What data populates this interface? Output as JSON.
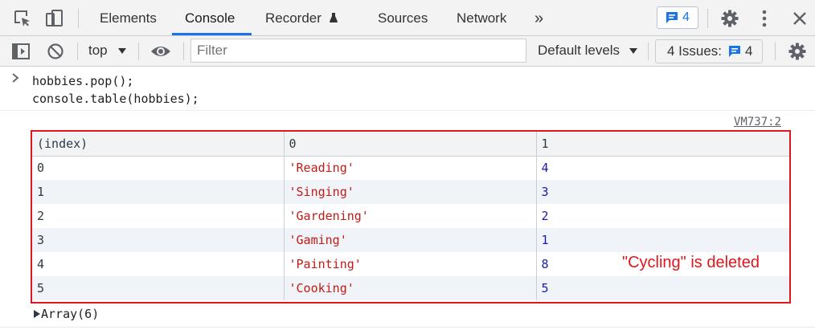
{
  "tabs": [
    {
      "label": "Elements"
    },
    {
      "label": "Console"
    },
    {
      "label": "Recorder"
    },
    {
      "label": "Sources"
    },
    {
      "label": "Network"
    }
  ],
  "active_tab": "Console",
  "more_tabs_glyph": "»",
  "message_badge_count": "4",
  "toolbar": {
    "context": "top",
    "filter_placeholder": "Filter",
    "levels_label": "Default levels",
    "issues_label": "4 Issues:",
    "issues_count": "4"
  },
  "console_input": {
    "line1": "hobbies.pop();",
    "line2": "console.table(hobbies);"
  },
  "source_link": "VM737:2",
  "table": {
    "headers": [
      "(index)",
      "0",
      "1"
    ],
    "rows": [
      {
        "index": "0",
        "name": "'Reading'",
        "value": "4"
      },
      {
        "index": "1",
        "name": "'Singing'",
        "value": "3"
      },
      {
        "index": "2",
        "name": "'Gardening'",
        "value": "2"
      },
      {
        "index": "3",
        "name": "'Gaming'",
        "value": "1"
      },
      {
        "index": "4",
        "name": "'Painting'",
        "value": "8"
      },
      {
        "index": "5",
        "name": "'Cooking'",
        "value": "5"
      }
    ]
  },
  "annotation": "\"Cycling\" is deleted",
  "array_summary": "Array(6)",
  "colors": {
    "accent": "#1a73e8",
    "string_value": "#c41a16",
    "number_value": "#1a1aa6",
    "annotation_red": "#e0161c"
  },
  "icons": [
    "inspect-element-icon",
    "device-toolbar-icon",
    "recorder-flask-icon",
    "message-icon",
    "settings-gear-icon",
    "kebab-menu-icon",
    "close-icon",
    "sidebar-toggle-icon",
    "clear-console-icon",
    "dropdown-arrow-icon",
    "eye-icon",
    "expand-triangle-icon",
    "prompt-chevron-icon"
  ]
}
